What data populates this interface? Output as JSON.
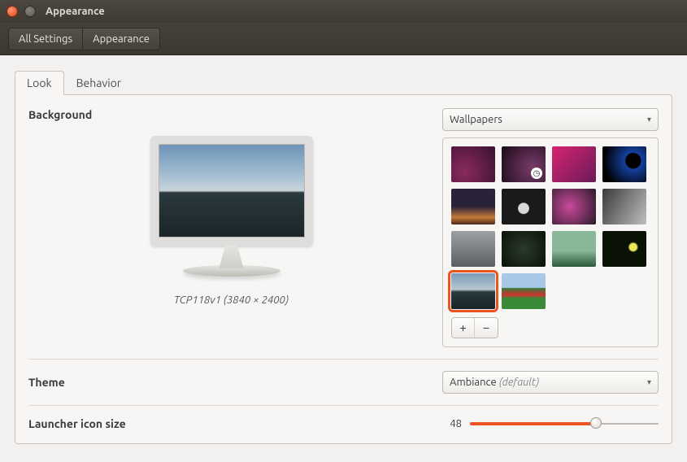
{
  "window": {
    "title": "Appearance"
  },
  "breadcrumb": {
    "all": "All Settings",
    "current": "Appearance"
  },
  "tabs": {
    "look": "Look",
    "behavior": "Behavior"
  },
  "sections": {
    "background": "Background",
    "theme": "Theme",
    "launcher": "Launcher icon size"
  },
  "wallpaper_source": {
    "selected": "Wallpapers"
  },
  "preview": {
    "caption": "TCP118v1 (3840 × 2400)"
  },
  "wallpapers": {
    "selected_index": 12,
    "clock_badge_index": 1
  },
  "buttons": {
    "add": "+",
    "remove": "−"
  },
  "theme": {
    "selected": "Ambiance",
    "suffix": "(default)"
  },
  "launcher": {
    "value": "48",
    "min": 16,
    "max": 64,
    "fill_pct": 67
  }
}
